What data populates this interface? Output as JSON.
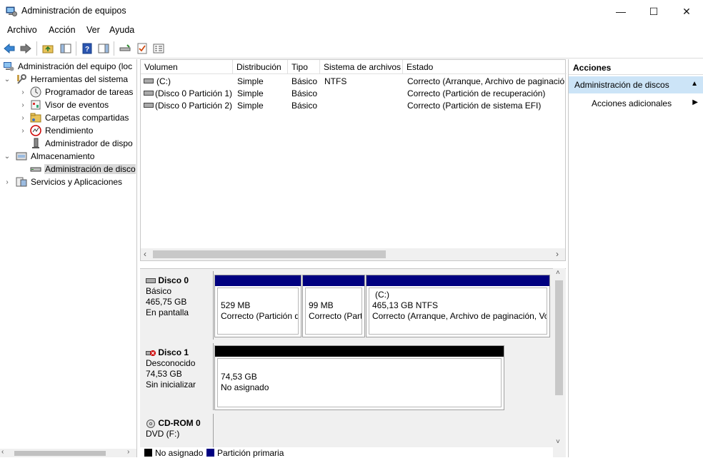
{
  "window": {
    "title": "Administración de equipos",
    "controls": {
      "minimize": "—",
      "maximize": "☐",
      "close": "✕"
    }
  },
  "menu": [
    "Archivo",
    "Acción",
    "Ver",
    "Ayuda"
  ],
  "tree": [
    {
      "label": "Administración del equipo (loc",
      "level": 0,
      "expander": "",
      "icon": "computer-management-icon"
    },
    {
      "label": "Herramientas del sistema",
      "level": 1,
      "expander": "⌄",
      "icon": "system-tools-icon"
    },
    {
      "label": "Programador de tareas",
      "level": 2,
      "expander": "›",
      "icon": "task-scheduler-icon"
    },
    {
      "label": "Visor de eventos",
      "level": 2,
      "expander": "›",
      "icon": "event-viewer-icon"
    },
    {
      "label": "Carpetas compartidas",
      "level": 2,
      "expander": "›",
      "icon": "shared-folders-icon"
    },
    {
      "label": "Rendimiento",
      "level": 2,
      "expander": "›",
      "icon": "performance-icon"
    },
    {
      "label": "Administrador de dispo",
      "level": 2,
      "expander": "",
      "icon": "device-manager-icon"
    },
    {
      "label": "Almacenamiento",
      "level": 1,
      "expander": "⌄",
      "icon": "storage-icon"
    },
    {
      "label": "Administración de disco",
      "level": 2,
      "expander": "",
      "icon": "disk-management-icon",
      "selected": true
    },
    {
      "label": "Servicios y Aplicaciones",
      "level": 1,
      "expander": "›",
      "icon": "services-apps-icon"
    }
  ],
  "volumes": {
    "columns": [
      "Volumen",
      "Distribución",
      "Tipo",
      "Sistema de archivos",
      "Estado"
    ],
    "rows": [
      [
        "(C:)",
        "Simple",
        "Básico",
        "NTFS",
        "Correcto (Arranque, Archivo de paginació"
      ],
      [
        "(Disco 0 Partición 1)",
        "Simple",
        "Básico",
        "",
        "Correcto (Partición de recuperación)"
      ],
      [
        "(Disco 0 Partición 2)",
        "Simple",
        "Básico",
        "",
        "Correcto (Partición de sistema EFI)"
      ]
    ]
  },
  "disks": [
    {
      "name": "Disco 0",
      "lines": [
        "Básico",
        "465,75 GB",
        "En pantalla"
      ],
      "partitions": [
        {
          "title": "",
          "size": "529 MB",
          "status": "Correcto (Partición de",
          "kind": "primary"
        },
        {
          "title": "",
          "size": "99 MB",
          "status": "Correcto (Part",
          "kind": "primary"
        },
        {
          "title": "(C:)",
          "size": "465,13 GB NTFS",
          "status": "Correcto (Arranque, Archivo de paginación, Vo",
          "kind": "primary"
        }
      ]
    },
    {
      "name": "Disco 1",
      "lines": [
        "Desconocido",
        "74,53 GB",
        "Sin inicializar"
      ],
      "partitions": [
        {
          "title": "",
          "size": "74,53 GB",
          "status": "No asignado",
          "kind": "unallocated"
        }
      ]
    },
    {
      "name": "CD-ROM 0",
      "lines": [
        "DVD (F:)"
      ],
      "partitions": []
    }
  ],
  "legend": [
    {
      "label": "No asignado",
      "color": "#000000"
    },
    {
      "label": "Partición primaria",
      "color": "#000080"
    }
  ],
  "actions": {
    "header": "Acciones",
    "section": "Administración de discos",
    "more": "Acciones adicionales"
  },
  "colors": {
    "primary_bar": "#000080",
    "unallocated_bar": "#000000",
    "selection": "#cce4f7"
  }
}
